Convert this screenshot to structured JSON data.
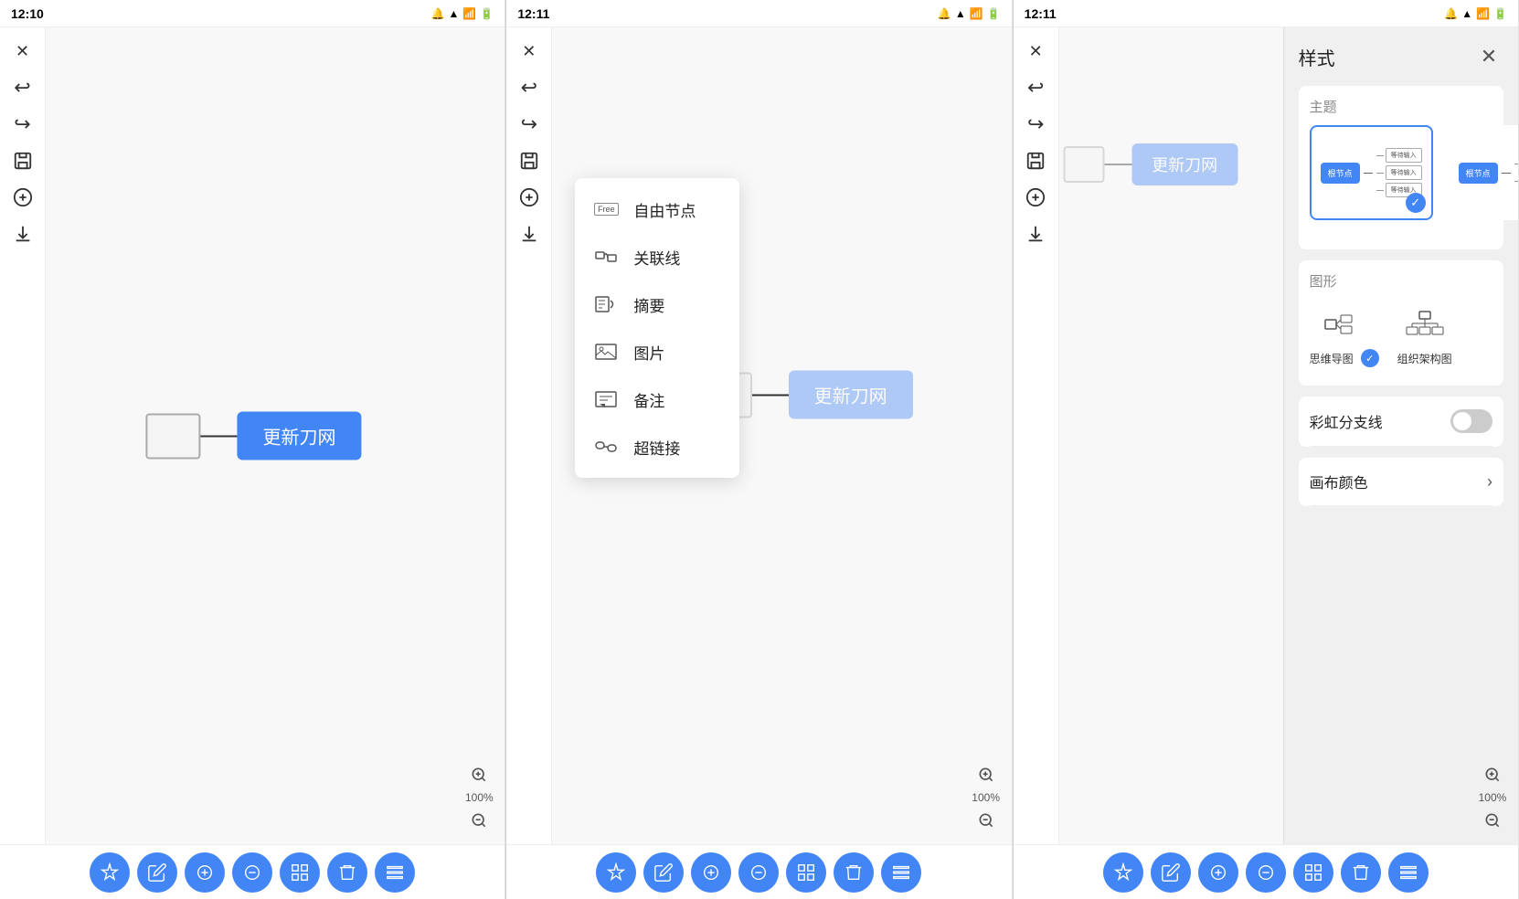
{
  "panels": [
    {
      "id": "panel1",
      "status": {
        "time": "12:10",
        "icons": [
          "notification",
          "wifi",
          "signal",
          "battery"
        ]
      },
      "toolbar": {
        "buttons": [
          {
            "name": "close",
            "icon": "✕"
          },
          {
            "name": "undo",
            "icon": "↩"
          },
          {
            "name": "redo",
            "icon": "↪"
          },
          {
            "name": "save",
            "icon": "💾"
          },
          {
            "name": "add",
            "icon": "⊕"
          },
          {
            "name": "download",
            "icon": "⬇"
          }
        ]
      },
      "canvas": {
        "rootNode": "",
        "childNode": "更新刀网"
      },
      "zoom": {
        "in": "+",
        "level": "100%",
        "out": "−"
      },
      "bottomToolbar": [
        {
          "name": "magic",
          "icon": "✦",
          "color": "blue"
        },
        {
          "name": "edit",
          "icon": "✏",
          "color": "blue"
        },
        {
          "name": "move-in",
          "icon": "⊙",
          "color": "blue"
        },
        {
          "name": "move-out",
          "icon": "⊙",
          "color": "blue"
        },
        {
          "name": "camera",
          "icon": "⊙",
          "color": "blue"
        },
        {
          "name": "delete",
          "icon": "🗑",
          "color": "blue"
        },
        {
          "name": "more",
          "icon": "≡",
          "color": "blue"
        }
      ]
    },
    {
      "id": "panel2",
      "status": {
        "time": "12:11",
        "icons": [
          "notification",
          "wifi",
          "signal",
          "battery"
        ]
      },
      "toolbar": {
        "buttons": [
          {
            "name": "close",
            "icon": "✕"
          },
          {
            "name": "undo",
            "icon": "↩"
          },
          {
            "name": "redo",
            "icon": "↪"
          },
          {
            "name": "save",
            "icon": "💾"
          },
          {
            "name": "add",
            "icon": "⊕"
          },
          {
            "name": "download",
            "icon": "⬇"
          }
        ]
      },
      "canvas": {
        "rootNode": "",
        "childNode": "更新刀网"
      },
      "popup": {
        "items": [
          {
            "name": "free-node",
            "icon": "FREE",
            "label": "自由节点",
            "iconType": "badge"
          },
          {
            "name": "relation-line",
            "icon": "🔗",
            "label": "关联线",
            "iconType": "relation"
          },
          {
            "name": "summary",
            "icon": "📋",
            "label": "摘要",
            "iconType": "summary"
          },
          {
            "name": "image",
            "icon": "🖼",
            "label": "图片",
            "iconType": "image"
          },
          {
            "name": "note",
            "icon": "📝",
            "label": "备注",
            "iconType": "note"
          },
          {
            "name": "hyperlink",
            "icon": "🔗",
            "label": "超链接",
            "iconType": "hyperlink"
          }
        ]
      },
      "zoom": {
        "in": "+",
        "level": "100%",
        "out": "−"
      },
      "bottomToolbar": [
        {
          "name": "magic",
          "icon": "✦",
          "color": "blue"
        },
        {
          "name": "edit",
          "icon": "✏",
          "color": "blue"
        },
        {
          "name": "move-in",
          "icon": "⊙",
          "color": "blue"
        },
        {
          "name": "move-out",
          "icon": "⊙",
          "color": "blue"
        },
        {
          "name": "camera",
          "icon": "⊙",
          "color": "blue"
        },
        {
          "name": "delete",
          "icon": "🗑",
          "color": "blue"
        },
        {
          "name": "more",
          "icon": "≡",
          "color": "blue"
        }
      ]
    },
    {
      "id": "panel3",
      "status": {
        "time": "12:11",
        "icons": [
          "notification",
          "wifi",
          "signal",
          "battery"
        ]
      },
      "toolbar": {
        "buttons": [
          {
            "name": "close",
            "icon": "✕"
          },
          {
            "name": "undo",
            "icon": "↩"
          },
          {
            "name": "redo",
            "icon": "↪"
          },
          {
            "name": "save",
            "icon": "💾"
          },
          {
            "name": "add",
            "icon": "⊕"
          },
          {
            "name": "download",
            "icon": "⬇"
          }
        ]
      },
      "canvas": {
        "rootNode": "",
        "childNode": "更新刀网"
      },
      "stylePanel": {
        "title": "样式",
        "sections": {
          "theme": {
            "label": "主题",
            "items": [
              {
                "id": "theme1",
                "selected": true
              },
              {
                "id": "theme2",
                "selected": false
              }
            ]
          },
          "shape": {
            "label": "图形",
            "items": [
              {
                "id": "mindmap",
                "name": "思维导图",
                "selected": true
              },
              {
                "id": "org",
                "name": "组织架构图",
                "selected": false
              }
            ]
          },
          "rainbow": {
            "label": "彩虹分支线",
            "enabled": false
          },
          "canvas": {
            "label": "画布颜色"
          }
        }
      },
      "zoom": {
        "in": "+",
        "level": "100%",
        "out": "−"
      },
      "bottomToolbar": [
        {
          "name": "magic",
          "icon": "✦",
          "color": "blue"
        },
        {
          "name": "edit",
          "icon": "✏",
          "color": "blue"
        },
        {
          "name": "move-in",
          "icon": "⊙",
          "color": "blue"
        },
        {
          "name": "move-out",
          "icon": "⊙",
          "color": "blue"
        },
        {
          "name": "camera",
          "icon": "⊙",
          "color": "blue"
        },
        {
          "name": "delete",
          "icon": "🗑",
          "color": "blue"
        },
        {
          "name": "more",
          "icon": "≡",
          "color": "blue"
        }
      ]
    }
  ]
}
